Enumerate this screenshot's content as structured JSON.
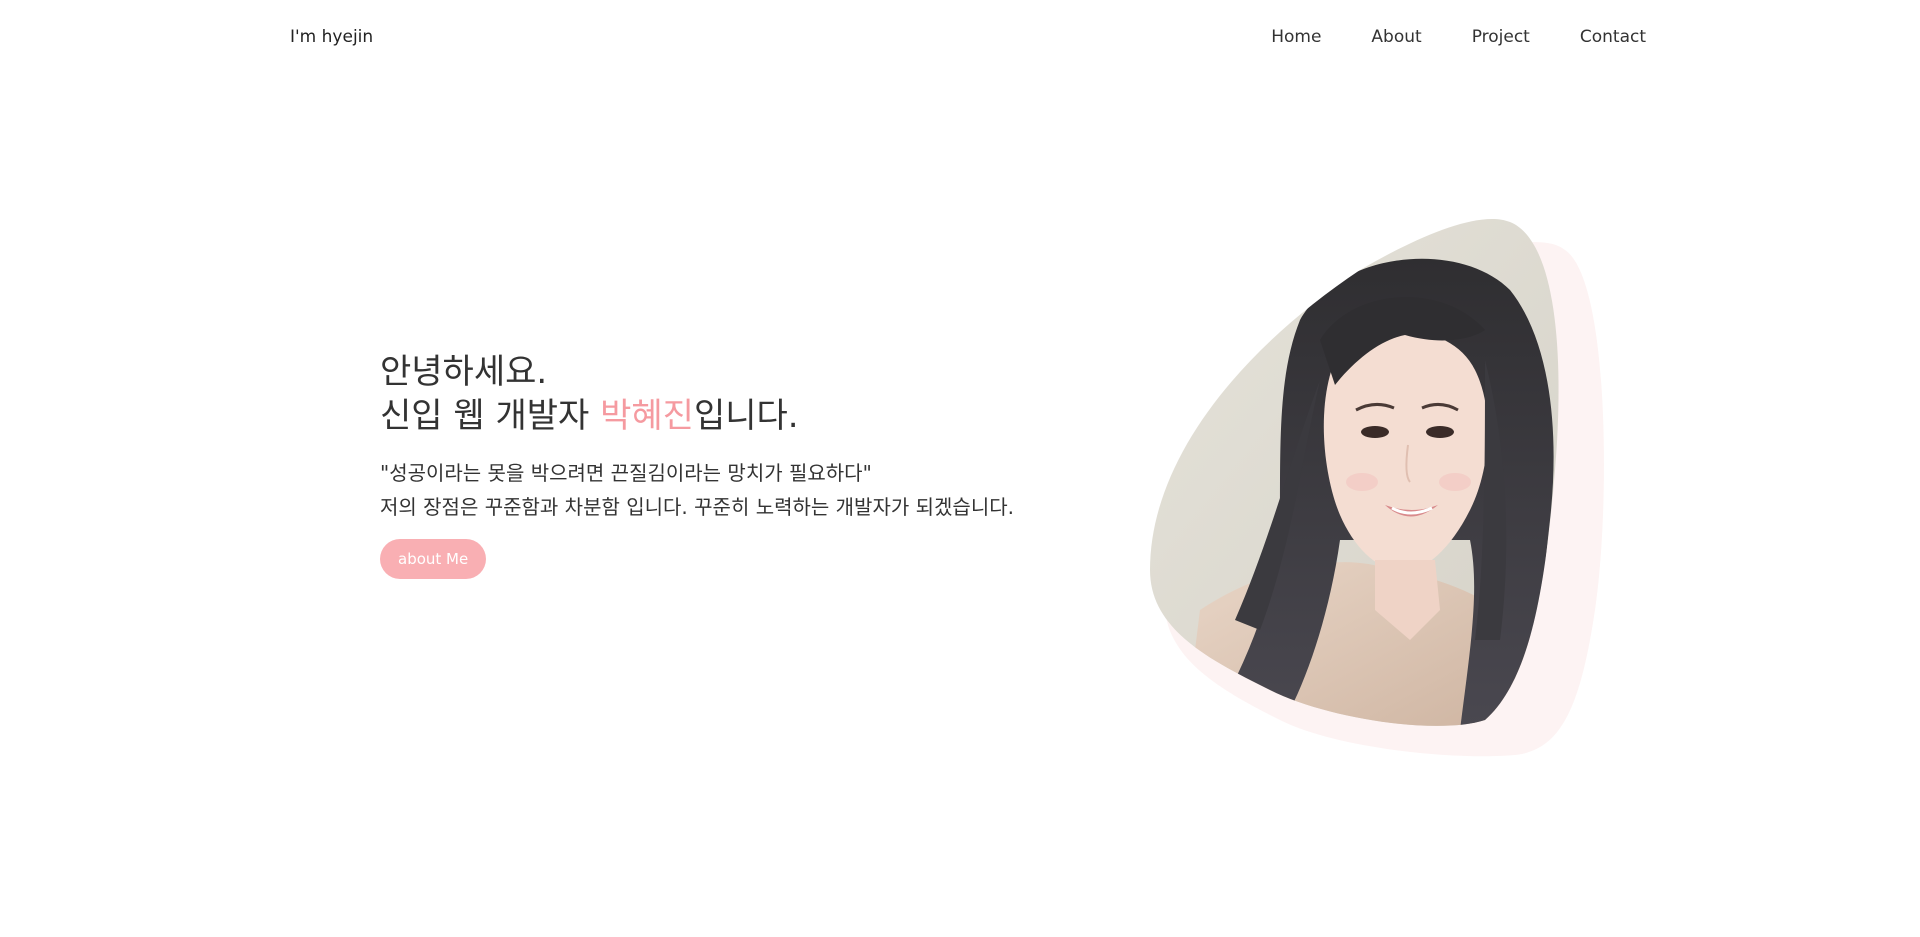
{
  "header": {
    "logo": "I'm hyejin",
    "nav": [
      "Home",
      "About",
      "Project",
      "Contact"
    ]
  },
  "hero": {
    "greeting_line1": "안녕하세요.",
    "greeting_line2_prefix": "신입 웹 개발자 ",
    "greeting_name": "박혜진",
    "greeting_line2_suffix": "입니다.",
    "quote_line1": "\"성공이라는 못을 박으려면 끈질김이라는 망치가 필요하다\"",
    "quote_line2": "저의 장점은 꾸준함과 차분함 입니다. 꾸준히 노력하는 개발자가 되겠습니다.",
    "button_label": "about Me"
  },
  "colors": {
    "accent": "#f59aa0",
    "button_bg": "#f9afb3",
    "blob_shadow": "#fdf3f3"
  }
}
